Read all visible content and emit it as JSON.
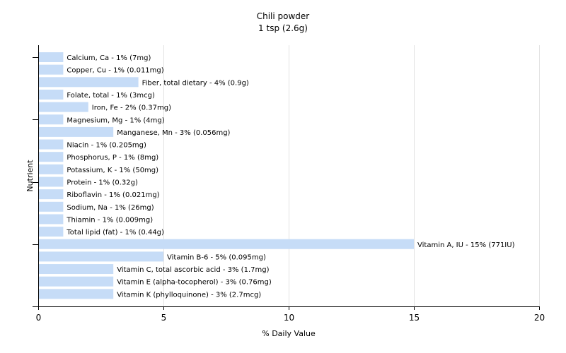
{
  "chart_data": {
    "type": "bar",
    "orientation": "horizontal",
    "title": "Chili powder",
    "subtitle": "1 tsp (2.6g)",
    "xlabel": "% Daily Value",
    "ylabel": "Nutrient",
    "xlim": [
      0,
      20
    ],
    "xticks": [
      "0",
      "5",
      "10",
      "15",
      "20"
    ],
    "grid": true,
    "bar_color": "#c6dcf7",
    "categories": [
      "Calcium, Ca",
      "Copper, Cu",
      "Fiber, total dietary",
      "Folate, total",
      "Iron, Fe",
      "Magnesium, Mg",
      "Manganese, Mn",
      "Niacin",
      "Phosphorus, P",
      "Potassium, K",
      "Protein",
      "Riboflavin",
      "Sodium, Na",
      "Thiamin",
      "Total lipid (fat)",
      "Vitamin A, IU",
      "Vitamin B-6",
      "Vitamin C, total ascorbic acid",
      "Vitamin E (alpha-tocopherol)",
      "Vitamin K (phylloquinone)"
    ],
    "values": [
      1,
      1,
      4,
      1,
      2,
      1,
      3,
      1,
      1,
      1,
      1,
      1,
      1,
      1,
      1,
      15,
      5,
      3,
      3,
      3
    ],
    "labels": [
      "Calcium, Ca - 1% (7mg)",
      "Copper, Cu - 1% (0.011mg)",
      "Fiber, total dietary - 4% (0.9g)",
      "Folate, total - 1% (3mcg)",
      "Iron, Fe - 2% (0.37mg)",
      "Magnesium, Mg - 1% (4mg)",
      "Manganese, Mn - 3% (0.056mg)",
      "Niacin - 1% (0.205mg)",
      "Phosphorus, P - 1% (8mg)",
      "Potassium, K - 1% (50mg)",
      "Protein - 1% (0.32g)",
      "Riboflavin - 1% (0.021mg)",
      "Sodium, Na - 1% (26mg)",
      "Thiamin - 1% (0.009mg)",
      "Total lipid (fat) - 1% (0.44g)",
      "Vitamin A, IU - 15% (771IU)",
      "Vitamin B-6 - 5% (0.095mg)",
      "Vitamin C, total ascorbic acid - 3% (1.7mg)",
      "Vitamin E (alpha-tocopherol) - 3% (0.76mg)",
      "Vitamin K (phylloquinone) - 3% (2.7mcg)"
    ]
  }
}
